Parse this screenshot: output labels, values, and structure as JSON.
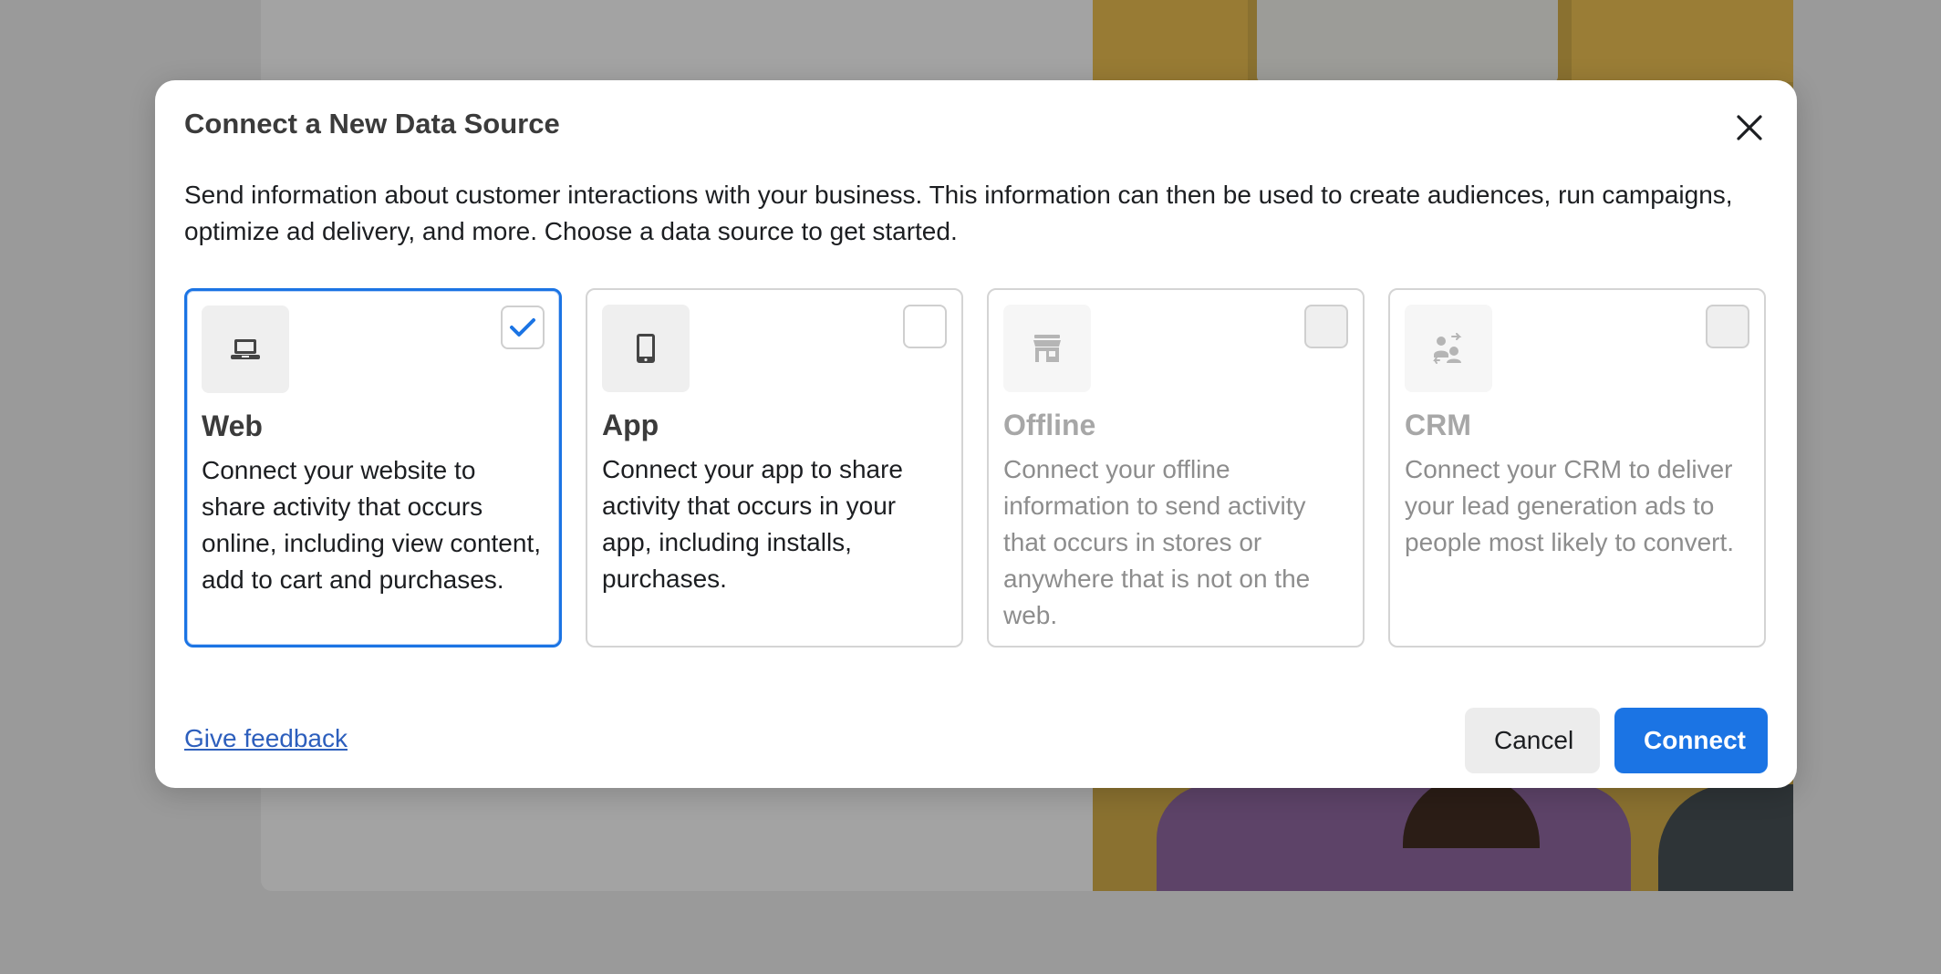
{
  "modal": {
    "title": "Connect a New Data Source",
    "description": "Send information about customer interactions with your business. This information can then be used to create audiences, run campaigns, optimize ad delivery, and more. Choose a data source to get started.",
    "close_icon": "close-icon"
  },
  "cards": [
    {
      "title": "Web",
      "description": "Connect your website to share activity that occurs online, including view content, add to cart and purchases.",
      "icon": "laptop-icon",
      "selected": true,
      "disabled": false
    },
    {
      "title": "App",
      "description": "Connect your app to share activity that occurs in your app, including installs, purchases.",
      "icon": "mobile-phone-icon",
      "selected": false,
      "disabled": false
    },
    {
      "title": "Offline",
      "description": "Connect your offline information to send activity that occurs in stores or anywhere that is not on the web.",
      "icon": "store-icon",
      "selected": false,
      "disabled": true
    },
    {
      "title": "CRM",
      "description": "Connect your CRM to deliver your lead generation ads to people most likely to convert.",
      "icon": "crm-people-icon",
      "selected": false,
      "disabled": true
    }
  ],
  "footer": {
    "feedback_label": "Give feedback",
    "cancel_label": "Cancel",
    "connect_label": "Connect"
  },
  "colors": {
    "accent": "#1b74e4",
    "link": "#2d5fbd",
    "overlay": "#9a9a9a"
  }
}
